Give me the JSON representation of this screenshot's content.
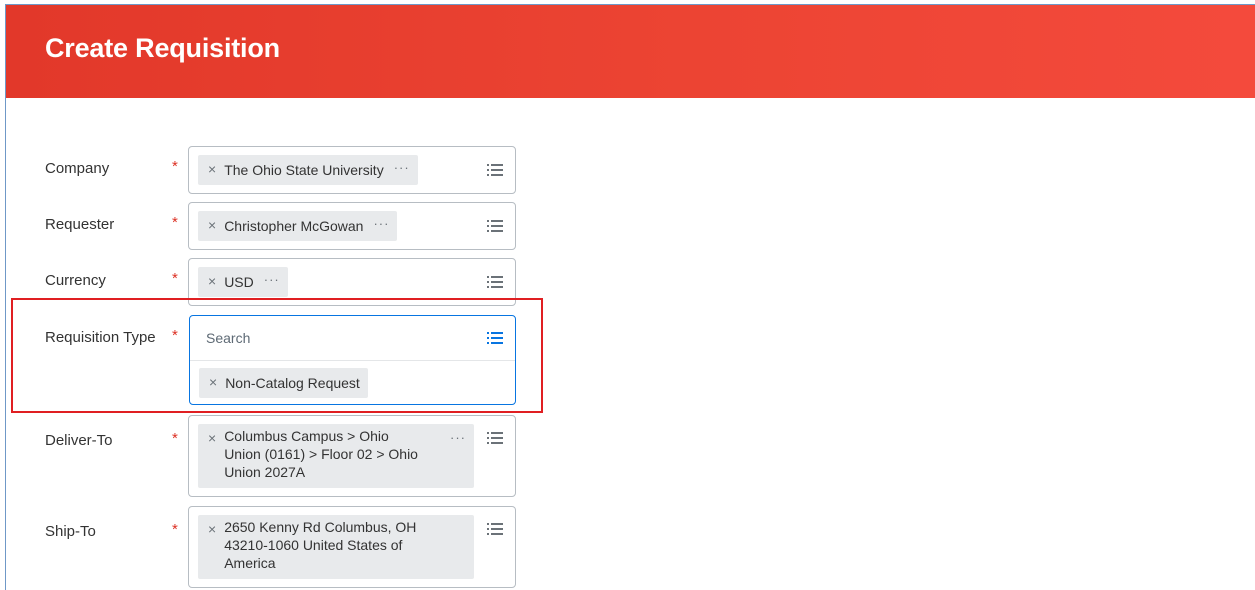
{
  "page": {
    "title": "Create Requisition"
  },
  "colors": {
    "header_gradient_start": "#e2382a",
    "header_gradient_end": "#f44a3c",
    "required_star": "#dc3024",
    "focus_blue": "#0875e1",
    "highlight_red": "#e01f22"
  },
  "form": {
    "required_marker": "*",
    "remove_glyph": "×",
    "more_glyph": "···",
    "company": {
      "label": "Company",
      "value": "The Ohio State University"
    },
    "requester": {
      "label": "Requester",
      "value": "Christopher McGowan"
    },
    "currency": {
      "label": "Currency",
      "value": "USD"
    },
    "requisition_type": {
      "label": "Requisition Type",
      "placeholder": "Search",
      "value": "Non-Catalog Request"
    },
    "deliver_to": {
      "label": "Deliver-To",
      "value": "Columbus Campus > Ohio\nUnion (0161) > Floor 02 > Ohio\nUnion 2027A"
    },
    "ship_to": {
      "label": "Ship-To",
      "value": "2650 Kenny Rd Columbus, OH\n43210-1060 United States of\nAmerica"
    }
  },
  "icons": {
    "prompt_list": "list-icon",
    "remove": "close-icon",
    "more": "more-options-icon"
  }
}
